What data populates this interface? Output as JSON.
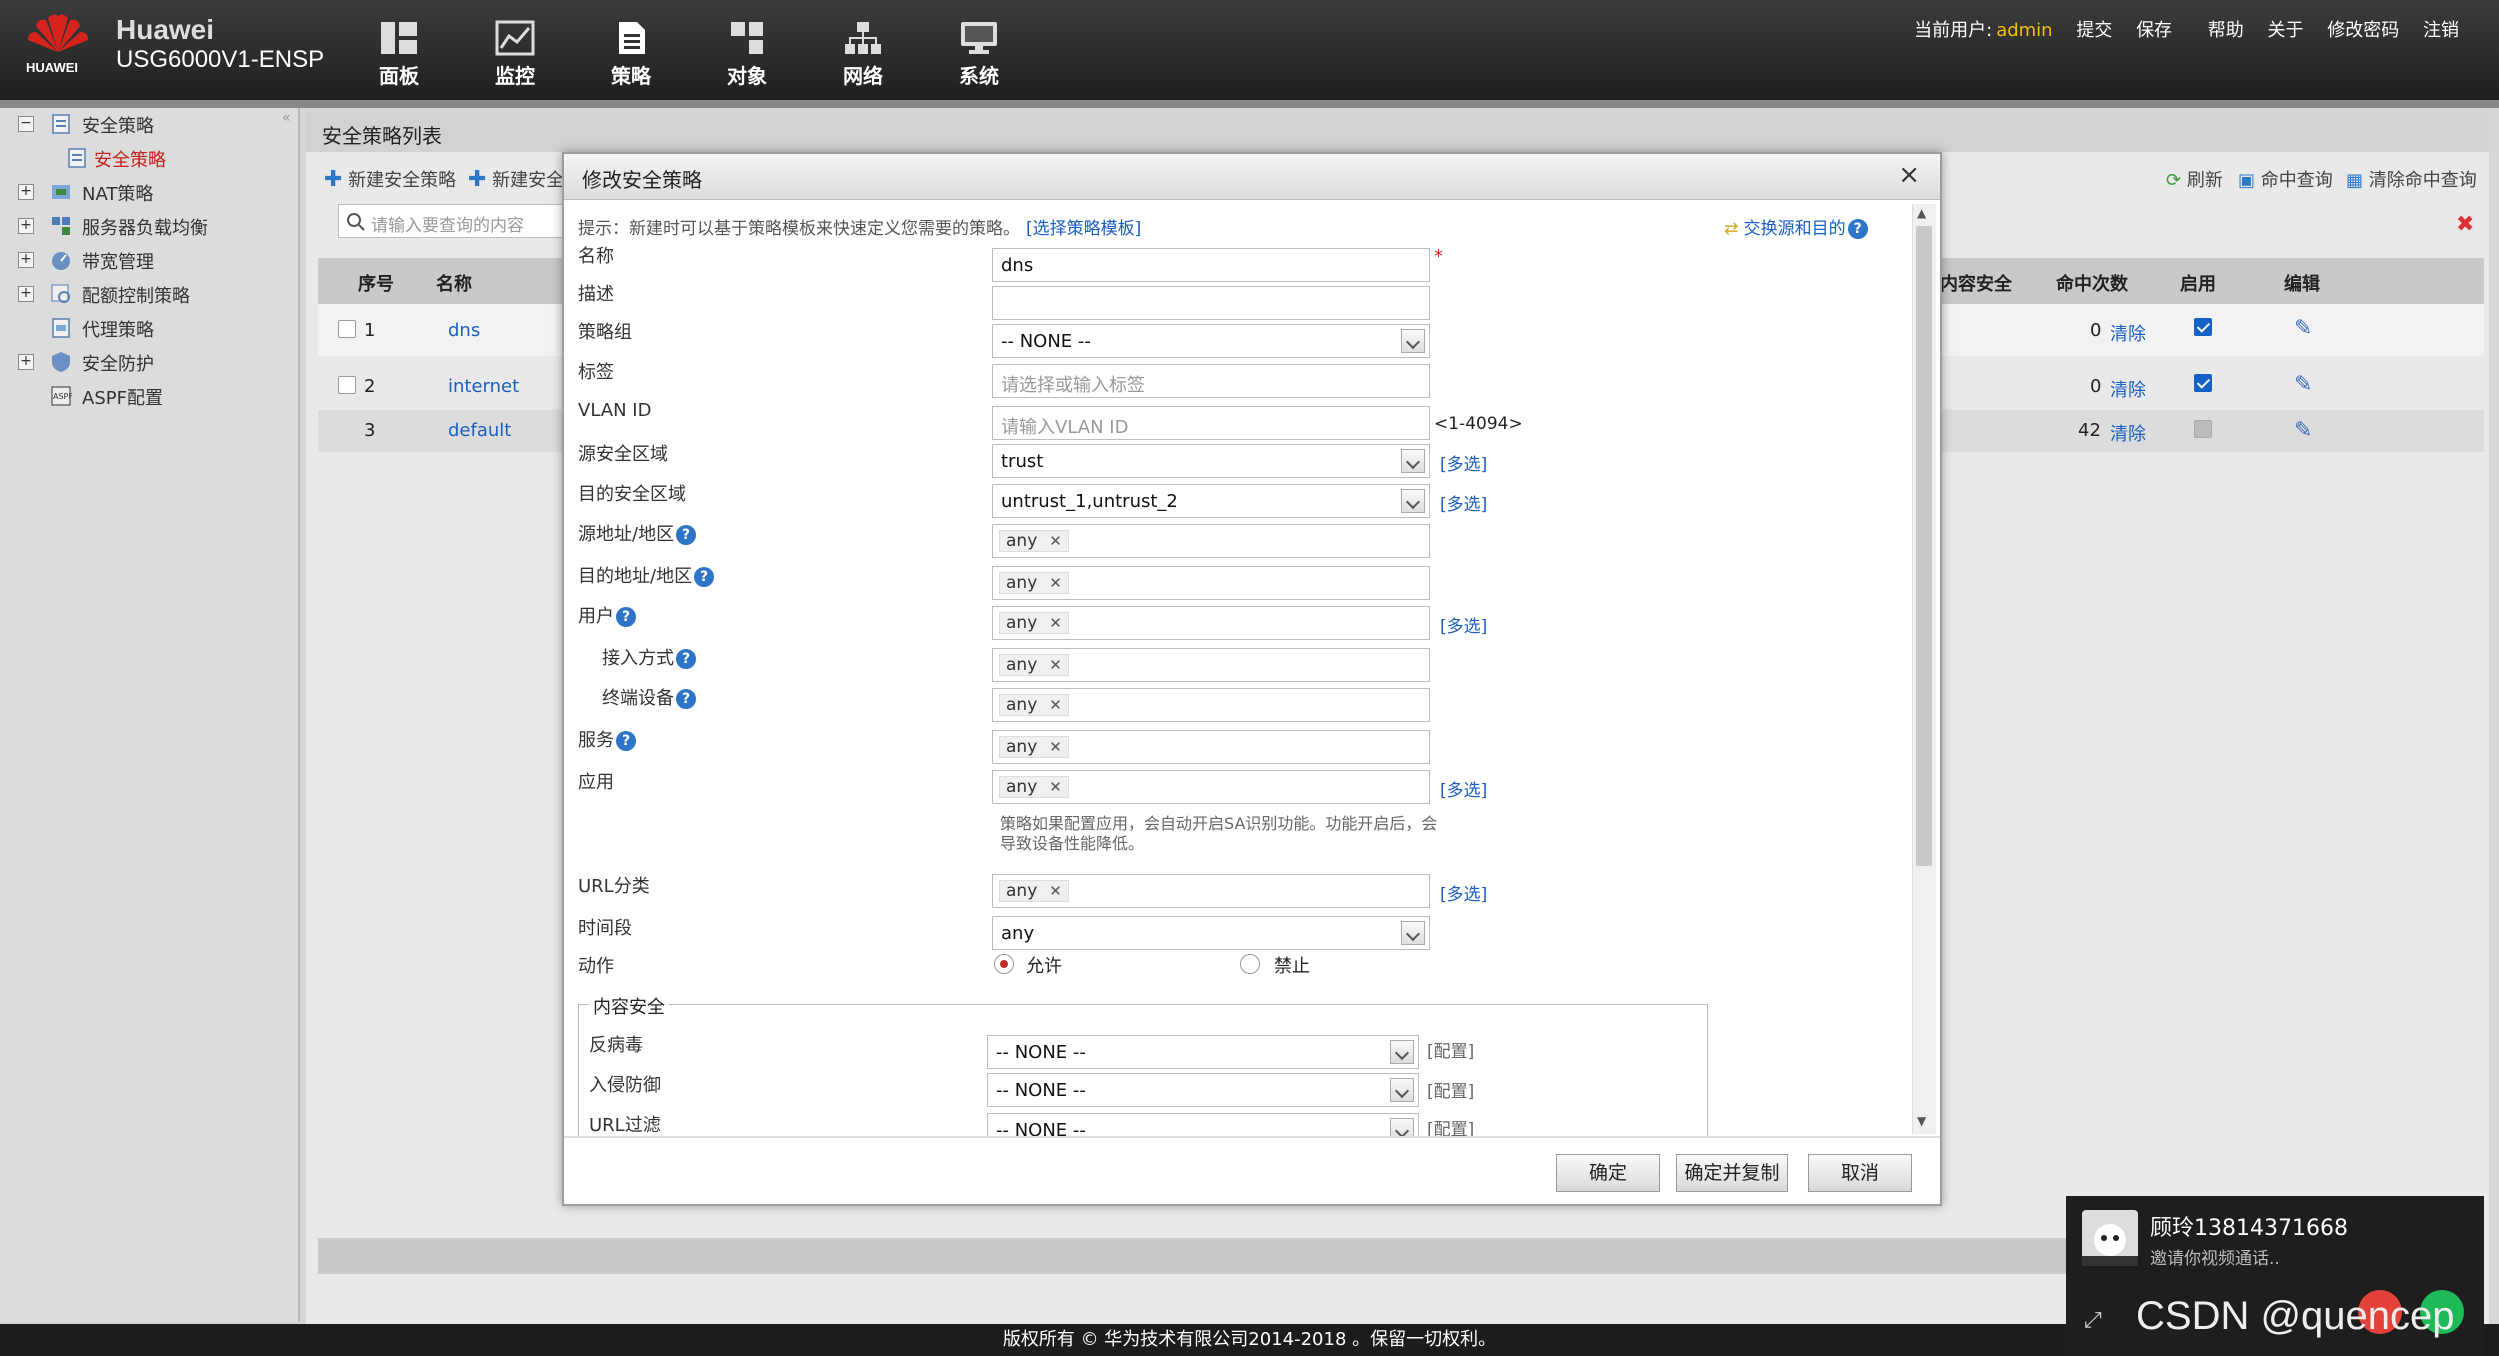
{
  "brand": {
    "name": "Huawei",
    "model": "USG6000V1-ENSP",
    "logo_text": "HUAWEI"
  },
  "nav": [
    {
      "label": "面板"
    },
    {
      "label": "监控"
    },
    {
      "label": "策略"
    },
    {
      "label": "对象"
    },
    {
      "label": "网络"
    },
    {
      "label": "系统"
    }
  ],
  "toplinks": {
    "user_label": "当前用户:",
    "user": "admin",
    "submit": "提交",
    "save": "保存",
    "help": "帮助",
    "about": "关于",
    "change_pwd": "修改密码",
    "logout": "注销"
  },
  "sidebar": {
    "items": [
      {
        "label": "安全策略"
      },
      {
        "label": "安全策略"
      },
      {
        "label": "NAT策略"
      },
      {
        "label": "服务器负载均衡"
      },
      {
        "label": "带宽管理"
      },
      {
        "label": "配额控制策略"
      },
      {
        "label": "代理策略"
      },
      {
        "label": "安全防护"
      },
      {
        "label": "ASPF配置"
      }
    ]
  },
  "main": {
    "title": "安全策略列表",
    "toolbar": {
      "new_policy": "新建安全策略",
      "new_group": "新建安全",
      "refresh": "刷新",
      "hit_query": "命中查询",
      "clear_hits": "清除命中查询"
    },
    "search_placeholder": "请输入要查询的内容",
    "columns": {
      "seq": "序号",
      "name": "名称",
      "content_sec": "内容安全",
      "hits": "命中次数",
      "enabled": "启用",
      "edit": "编辑"
    },
    "rows": [
      {
        "seq": "1",
        "name": "dns",
        "hits": "0",
        "clear": "清除",
        "enabled": true
      },
      {
        "seq": "2",
        "name": "internet",
        "hits": "0",
        "clear": "清除",
        "enabled": true
      },
      {
        "seq": "3",
        "name": "default",
        "hits": "42",
        "clear": "清除",
        "enabled": true
      }
    ]
  },
  "dialog": {
    "title": "修改安全策略",
    "close": "×",
    "hint": "提示：新建时可以基于策略模板来快速定义您需要的策略。",
    "template_link": "[选择策略模板]",
    "swap_link": "交换源和目的",
    "fields": {
      "name_label": "名称",
      "name_value": "dns",
      "required_mark": "*",
      "desc_label": "描述",
      "group_label": "策略组",
      "group_value": "-- NONE --",
      "tag_label": "标签",
      "tag_placeholder": "请选择或输入标签",
      "vlan_label": "VLAN ID",
      "vlan_placeholder": "请输入VLAN ID",
      "vlan_range": "<1-4094>",
      "src_zone_label": "源安全区域",
      "src_zone_value": "trust",
      "dst_zone_label": "目的安全区域",
      "dst_zone_value": "untrust_1,untrust_2",
      "src_addr_label": "源地址/地区",
      "dst_addr_label": "目的地址/地区",
      "user_label": "用户",
      "access_label": "接入方式",
      "terminal_label": "终端设备",
      "service_label": "服务",
      "app_label": "应用",
      "app_note": "策略如果配置应用，会自动开启SA识别功能。功能开启后，会导致设备性能降低。",
      "url_label": "URL分类",
      "time_label": "时间段",
      "time_value": "any",
      "action_label": "动作",
      "allow": "允许",
      "deny": "禁止",
      "any": "any",
      "multi": "[多选]"
    },
    "content_security": {
      "legend": "内容安全",
      "antivirus_label": "反病毒",
      "antivirus_value": "-- NONE --",
      "ips_label": "入侵防御",
      "ips_value": "-- NONE --",
      "url_filter_label": "URL过滤",
      "url_filter_value": "-- NONE --",
      "config": "[配置]"
    },
    "buttons": {
      "ok": "确定",
      "ok_copy": "确定并复制",
      "cancel": "取消"
    }
  },
  "footer": "版权所有 © 华为技术有限公司2014-2018 。保留一切权利。",
  "notification": {
    "caller": "顾玲13814371668",
    "message": "邀请你视频通话..",
    "watermark": "CSDN @quencep"
  }
}
